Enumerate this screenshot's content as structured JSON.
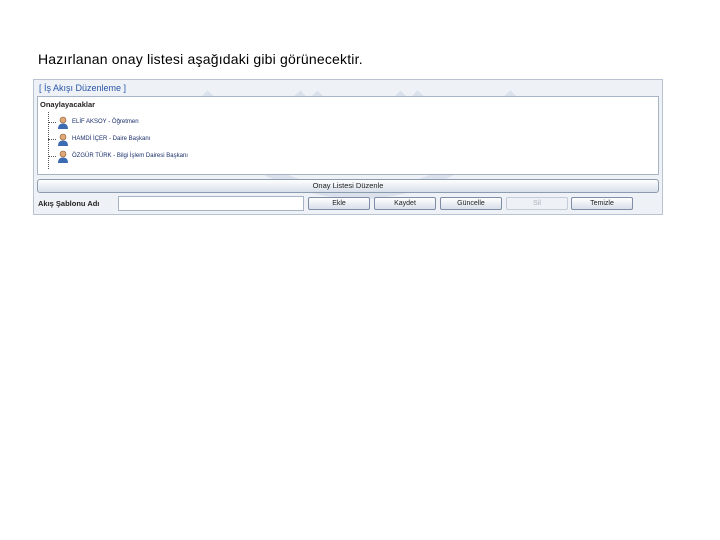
{
  "caption": "Hazırlanan onay listesi aşağıdaki gibi görünecektir.",
  "window": {
    "title": "[ İş Akışı Düzenleme ]",
    "panel_label": "Onaylayacaklar",
    "approvers": [
      {
        "name": "ELİF AKSOY - Öğretmen"
      },
      {
        "name": "HAMDİ İÇER - Daire Başkanı"
      },
      {
        "name": "ÖZGÜR TÜRK - Bilgi İşlem Dairesi Başkanı"
      }
    ],
    "arrange_button": "Onay Listesi Düzenle",
    "template_label": "Akış Şablonu Adı",
    "template_value": "",
    "buttons": {
      "ekle": "Ekle",
      "kaydet": "Kaydet",
      "guncelle": "Güncelle",
      "sil": "Sil",
      "temizle": "Temizle"
    }
  },
  "colors": {
    "title_text": "#2a55a8",
    "panel_bg": "#eef2f7",
    "border": "#a6b4c6"
  },
  "icons": {
    "approver": "user-icon"
  }
}
